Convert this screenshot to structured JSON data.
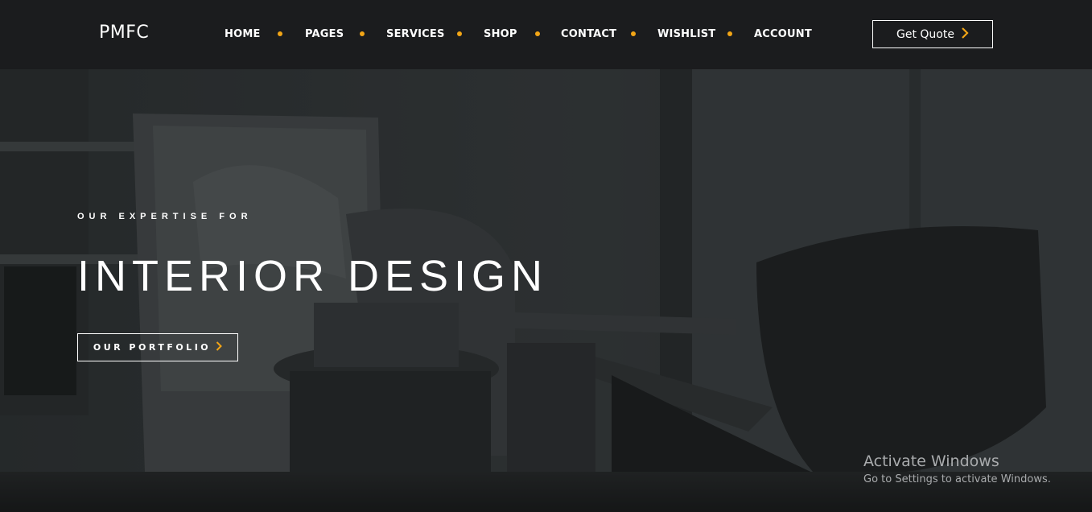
{
  "header": {
    "logo": "PMFC",
    "nav": [
      {
        "label": "HOME"
      },
      {
        "label": "PAGES"
      },
      {
        "label": "SERVICES"
      },
      {
        "label": "SHOP"
      },
      {
        "label": "CONTACT"
      },
      {
        "label": "WISHLIST"
      },
      {
        "label": "ACCOUNT"
      }
    ],
    "quote_label": "Get Quote",
    "accent": "#f2a516",
    "background": "#1b1c1e"
  },
  "hero": {
    "eyebrow": "OUR EXPERTISE FOR",
    "headline": "INTERIOR DESIGN",
    "portfolio_label": "OUR PORTFOLIO"
  },
  "watermark": {
    "title": "Activate Windows",
    "subtitle": "Go to Settings to activate Windows."
  },
  "icons": {
    "quote_icon": "chevron-right-icon",
    "portfolio_icon": "chevron-right-icon"
  }
}
